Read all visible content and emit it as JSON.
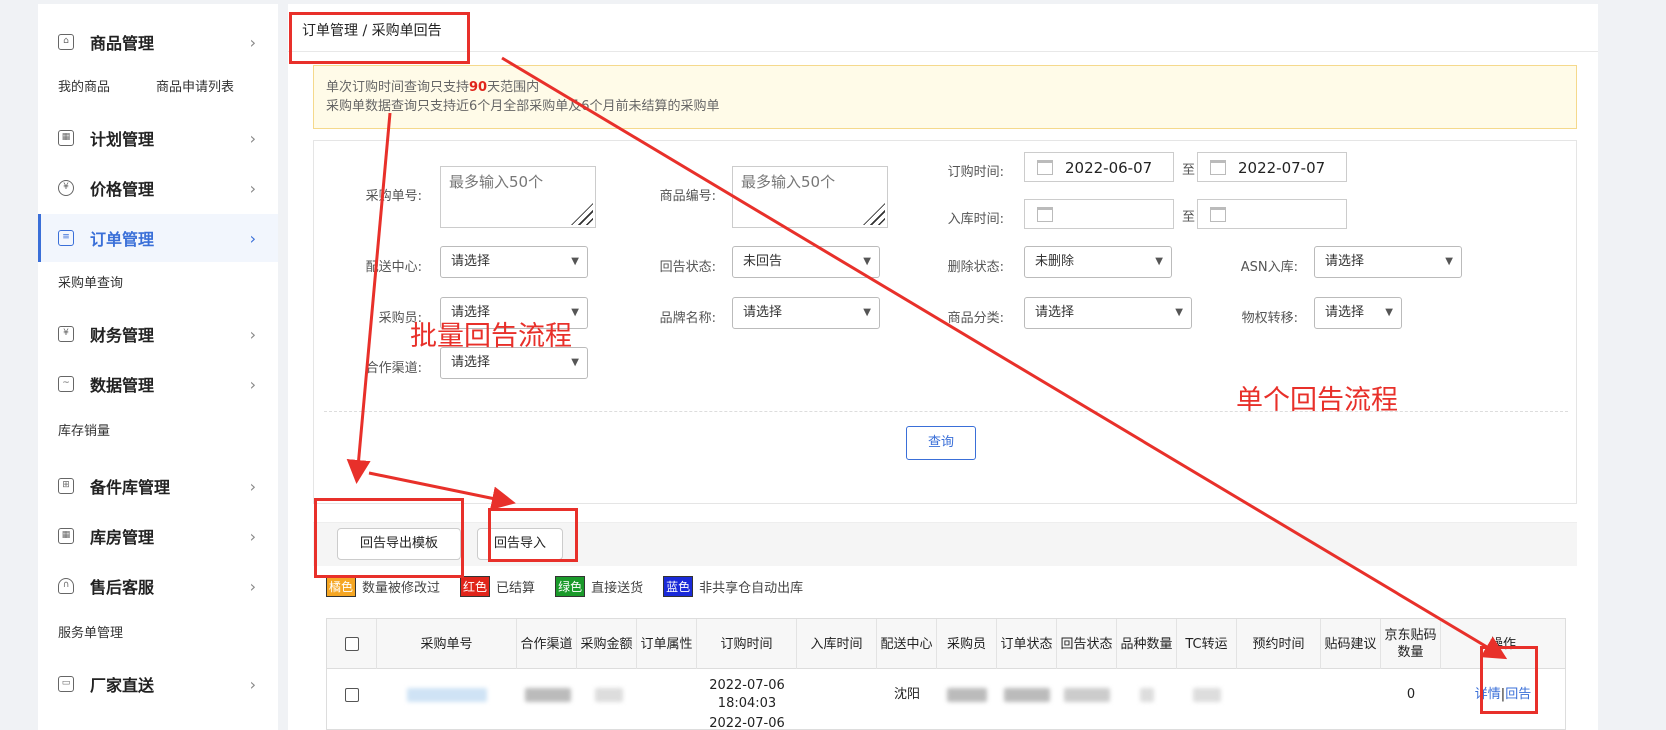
{
  "sidebar": {
    "sections": [
      {
        "label": "商品管理",
        "icon": "bag-icon",
        "subs": [
          "我的商品",
          "商品申请列表"
        ]
      },
      {
        "label": "计划管理",
        "icon": "grid-icon",
        "subs": []
      },
      {
        "label": "价格管理",
        "icon": "yen-icon",
        "subs": []
      },
      {
        "label": "订单管理",
        "icon": "order-icon",
        "subs": [
          "采购单查询"
        ]
      },
      {
        "label": "财务管理",
        "icon": "finance-icon",
        "subs": []
      },
      {
        "label": "数据管理",
        "icon": "chart-icon",
        "subs": [
          "库存销量"
        ]
      },
      {
        "label": "备件库管理",
        "icon": "parts-icon",
        "subs": []
      },
      {
        "label": "库房管理",
        "icon": "warehouse-icon",
        "subs": []
      },
      {
        "label": "售后客服",
        "icon": "headset-icon",
        "subs": [
          "服务单管理"
        ]
      },
      {
        "label": "厂家直送",
        "icon": "truck-icon",
        "subs": []
      }
    ]
  },
  "breadcrumb": "订单管理 / 采购单回告",
  "notice": {
    "line1_prefix": "单次订购时间查询只支持",
    "line1_num": "90",
    "line1_suffix": "天范围内",
    "line2": "采购单数据查询只支持近6个月全部采购单及6个月前未结算的采购单"
  },
  "filters": {
    "po_no_label": "采购单号:",
    "po_no_placeholder": "最多输入50个",
    "sku_label": "商品编号:",
    "sku_placeholder": "最多输入50个",
    "order_time_label": "订购时间:",
    "order_time_from": "2022-06-07",
    "order_time_to": "2022-07-07",
    "to": "至",
    "instock_time_label": "入库时间:",
    "dc_label": "配送中心:",
    "dc_value": "请选择",
    "reply_status_label": "回告状态:",
    "reply_status_value": "未回告",
    "delete_status_label": "删除状态:",
    "delete_status_value": "未删除",
    "asn_label": "ASN入库:",
    "asn_value": "请选择",
    "buyer_label": "采购员:",
    "buyer_value": "请选择",
    "brand_label": "品牌名称:",
    "brand_value": "请选择",
    "category_label": "商品分类:",
    "category_value": "请选择",
    "transfer_label": "物权转移:",
    "transfer_value": "请选择",
    "channel_label": "合作渠道:",
    "channel_value": "请选择",
    "query_button": "查询"
  },
  "actions": {
    "export_template": "回告导出模板",
    "import": "回告导入"
  },
  "legend": [
    {
      "tag": "橘色",
      "text": "数量被修改过",
      "color": "#f5a623"
    },
    {
      "tag": "红色",
      "text": "已结算",
      "color": "#e0251b"
    },
    {
      "tag": "绿色",
      "text": "直接送货",
      "color": "#1a9a2a"
    },
    {
      "tag": "蓝色",
      "text": "非共享仓自动出库",
      "color": "#1a2ad8"
    }
  ],
  "table": {
    "columns": [
      "采购单号",
      "合作渠道",
      "采购金额",
      "订单属性",
      "订购时间",
      "入库时间",
      "配送中心",
      "采购员",
      "订单状态",
      "回告状态",
      "品种数量",
      "TC转运",
      "预约时间",
      "贴码建议",
      "京东贴码数量",
      "操作"
    ],
    "row1": {
      "order_date": "2022-07-06",
      "order_time": "18:04:03",
      "dc": "沈阳",
      "jd_label_qty": "0",
      "detail": "详情",
      "reply": "回告"
    },
    "row2_partial": "2022-07-06"
  },
  "annotations": {
    "batch": "批量回告流程",
    "single": "单个回告流程"
  }
}
